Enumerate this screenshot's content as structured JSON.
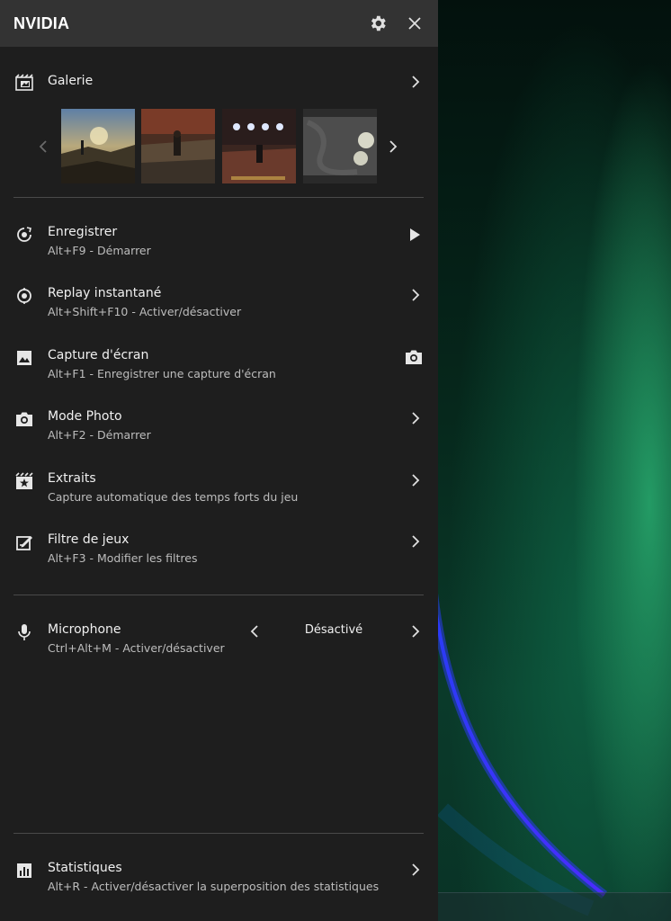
{
  "header": {
    "title": "NVIDIA",
    "settings_icon": "gear-icon",
    "close_icon": "close-icon"
  },
  "gallery": {
    "title": "Galerie",
    "icon": "gallery-film-icon",
    "thumbnails": [
      "screenshot-1",
      "screenshot-2",
      "screenshot-3",
      "screenshot-4"
    ]
  },
  "items": [
    {
      "title": "Enregistrer",
      "subtitle": "Alt+F9 - Démarrer",
      "icon": "record-icon",
      "action_icon": "play-icon"
    },
    {
      "title": "Replay instantané",
      "subtitle": "Alt+Shift+F10 - Activer/désactiver",
      "icon": "instant-replay-icon",
      "action_icon": "chevron-right-icon"
    },
    {
      "title": "Capture d'écran",
      "subtitle": "Alt+F1 - Enregistrer une capture d'écran",
      "icon": "image-icon",
      "action_icon": "camera-icon"
    },
    {
      "title": "Mode Photo",
      "subtitle": "Alt+F2 - Démarrer",
      "icon": "camera-icon",
      "action_icon": "chevron-right-icon"
    },
    {
      "title": "Extraits",
      "subtitle": "Capture automatique des temps forts du jeu",
      "icon": "highlights-icon",
      "action_icon": "chevron-right-icon"
    },
    {
      "title": "Filtre de jeux",
      "subtitle": "Alt+F3 - Modifier les filtres",
      "icon": "filter-icon",
      "action_icon": "chevron-right-icon"
    }
  ],
  "microphone": {
    "title": "Microphone",
    "subtitle": "Ctrl+Alt+M - Activer/désactiver",
    "value": "Désactivé",
    "icon": "microphone-icon"
  },
  "statistics": {
    "title": "Statistiques",
    "subtitle": "Alt+R - Activer/désactiver la superposition des statistiques",
    "icon": "statistics-icon"
  },
  "colors": {
    "panel_bg": "#1e1e1e",
    "header_bg": "#333333",
    "text_primary": "#f0f0f0",
    "text_secondary": "#bdbdbd"
  }
}
